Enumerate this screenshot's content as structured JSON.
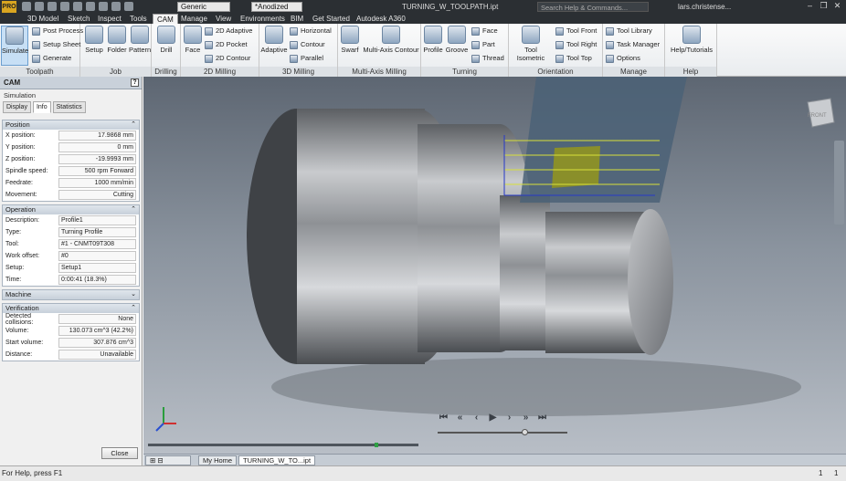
{
  "titlebar": {
    "app_logo": "PRO",
    "doc_title": "TURNING_W_TOOLPATH.ipt",
    "search_placeholder": "Search Help & Commands...",
    "user": "lars.christense...",
    "appearance_value": "Generic",
    "material_value": "*Anodized"
  },
  "tabs": [
    "3D Model",
    "Sketch",
    "Inspect",
    "Tools",
    "CAM",
    "Manage",
    "View",
    "Environments",
    "BIM",
    "Get Started",
    "Autodesk A360"
  ],
  "active_tab": "CAM",
  "ribbon": {
    "toolpath": {
      "label": "Toolpath",
      "simulate": "Simulate",
      "post_process": "Post Process",
      "setup_sheet": "Setup Sheet",
      "generate": "Generate"
    },
    "job": {
      "label": "Job",
      "setup": "Setup",
      "folder": "Folder",
      "pattern": "Pattern"
    },
    "drilling": {
      "label": "Drilling",
      "drill": "Drill"
    },
    "milling2d": {
      "label": "2D Milling",
      "face": "Face",
      "adaptive2d": "2D Adaptive",
      "pocket2d": "2D Pocket",
      "contour2d": "2D Contour"
    },
    "milling3d": {
      "label": "3D Milling",
      "adaptive": "Adaptive",
      "horizontal": "Horizontal",
      "contour": "Contour",
      "parallel": "Parallel"
    },
    "multiaxis": {
      "label": "Multi-Axis Milling",
      "swarf": "Swarf",
      "multi_axis_contour": "Multi-Axis Contour"
    },
    "turning": {
      "label": "Turning",
      "profile": "Profile",
      "groove": "Groove",
      "face": "Face",
      "part": "Part",
      "thread": "Thread"
    },
    "orientation": {
      "label": "Orientation",
      "tool_isometric": "Tool Isometric",
      "tool_front": "Tool Front",
      "tool_right": "Tool Right",
      "tool_top": "Tool Top"
    },
    "manage": {
      "label": "Manage",
      "tool_library": "Tool Library",
      "task_manager": "Task Manager",
      "options": "Options"
    },
    "help": {
      "label": "Help",
      "help_tutorials": "Help/Tutorials"
    }
  },
  "browser": {
    "title": "CAM",
    "subtitle": "Simulation",
    "subtabs": [
      "Display",
      "Info",
      "Statistics"
    ],
    "position": {
      "label": "Position",
      "rows": [
        {
          "k": "X position:",
          "v": "17.9868 mm"
        },
        {
          "k": "Y position:",
          "v": "0 mm"
        },
        {
          "k": "Z position:",
          "v": "-19.9993 mm"
        },
        {
          "k": "Spindle speed:",
          "v": "500 rpm Forward"
        },
        {
          "k": "Feedrate:",
          "v": "1000 mm/min"
        },
        {
          "k": "Movement:",
          "v": "Cutting"
        }
      ]
    },
    "operation": {
      "label": "Operation",
      "rows": [
        {
          "k": "Description:",
          "v": "Profile1"
        },
        {
          "k": "Type:",
          "v": "Turning Profile"
        },
        {
          "k": "Tool:",
          "v": "#1 - CNMT09T308"
        },
        {
          "k": "Work offset:",
          "v": "#0"
        },
        {
          "k": "Setup:",
          "v": "Setup1"
        },
        {
          "k": "Time:",
          "v": "0:00:41 (18.3%)"
        }
      ]
    },
    "machine": {
      "label": "Machine"
    },
    "verification": {
      "label": "Verification",
      "rows": [
        {
          "k": "Detected collisions:",
          "v": "None"
        },
        {
          "k": "Volume:",
          "v": "130.073 cm^3 (42.2%)"
        },
        {
          "k": "Start volume:",
          "v": "307.876 cm^3"
        },
        {
          "k": "Distance:",
          "v": "Unavailable"
        }
      ]
    },
    "close_label": "Close"
  },
  "viewcube_label": "FRONT",
  "doc_tabs": [
    "My Home",
    "TURNING_W_TO...ipt"
  ],
  "status": {
    "text": "For Help, press F1",
    "n1": "1",
    "n2": "1"
  }
}
